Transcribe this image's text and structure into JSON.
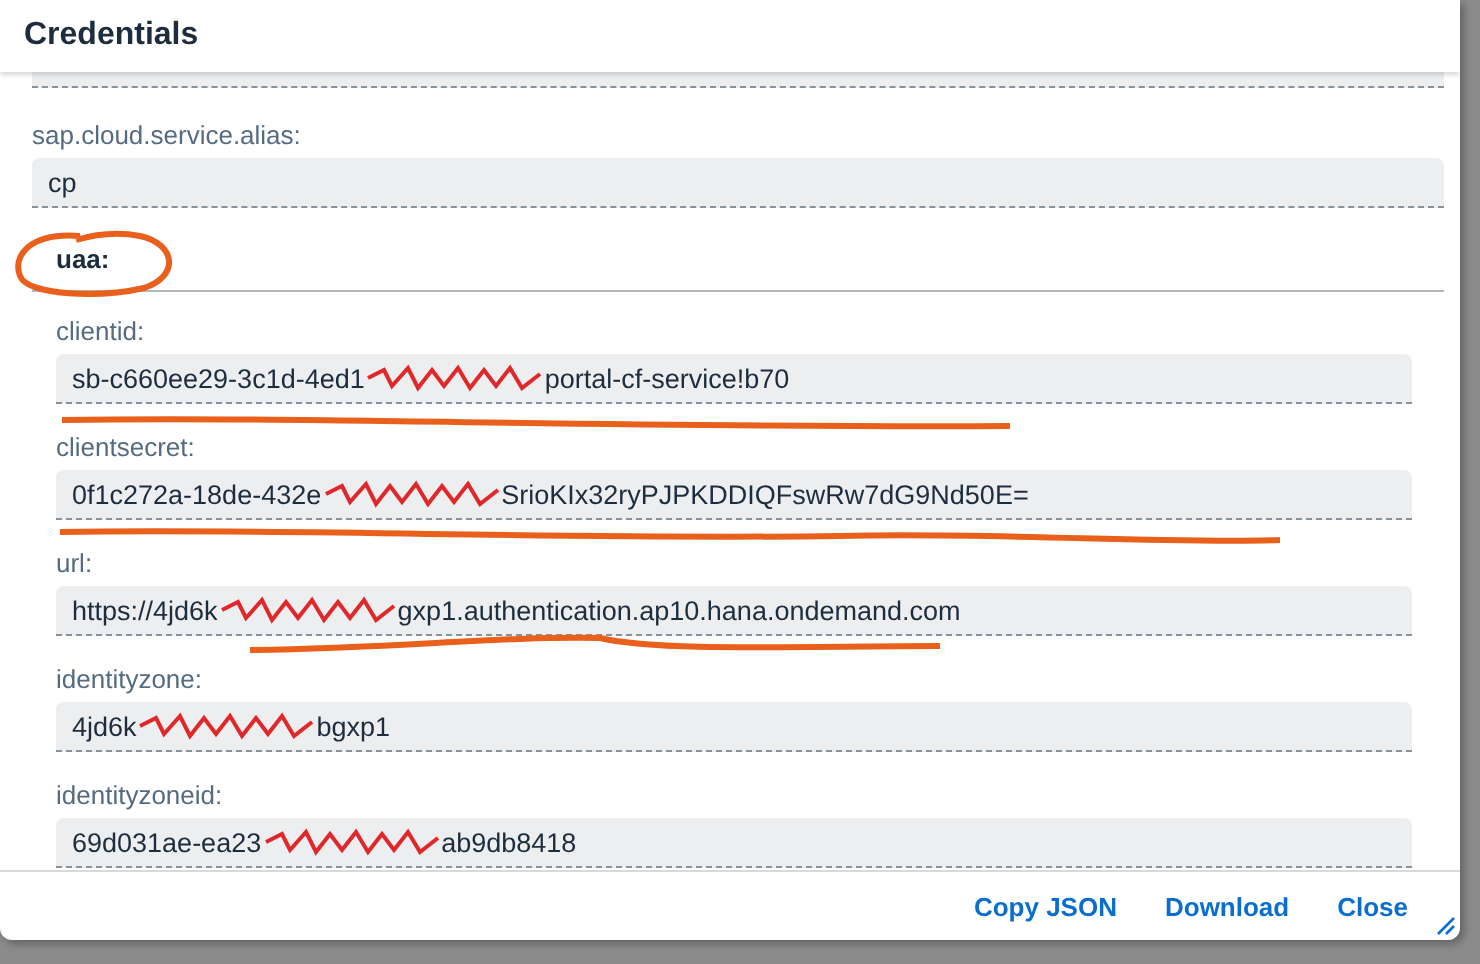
{
  "dialog": {
    "title": "Credentials"
  },
  "fields": [
    {
      "kind": "partial"
    },
    {
      "kind": "field",
      "label": "sap.cloud.service.alias:",
      "value": [
        {
          "kind": "text",
          "text": "cp"
        }
      ]
    },
    {
      "kind": "group",
      "label": "uaa:",
      "children": [
        {
          "kind": "field",
          "label": "clientid:",
          "value": [
            {
              "kind": "text",
              "text": "sb-c660ee29-3c1d-4ed1"
            },
            {
              "kind": "scribble"
            },
            {
              "kind": "text",
              "text": "portal-cf-service!b70"
            }
          ]
        },
        {
          "kind": "field",
          "label": "clientsecret:",
          "value": [
            {
              "kind": "text",
              "text": "0f1c272a-18de-432e"
            },
            {
              "kind": "scribble"
            },
            {
              "kind": "text",
              "text": "SrioKIx32ryPJPKDDIQFswRw7dG9Nd50E="
            }
          ]
        },
        {
          "kind": "field",
          "label": "url:",
          "value": [
            {
              "kind": "text",
              "text": "https://4jd6k"
            },
            {
              "kind": "scribble"
            },
            {
              "kind": "text",
              "text": "gxp1.authentication.ap10.hana.ondemand.com"
            }
          ]
        },
        {
          "kind": "field",
          "label": "identityzone:",
          "value": [
            {
              "kind": "text",
              "text": "4jd6k"
            },
            {
              "kind": "scribble"
            },
            {
              "kind": "text",
              "text": "bgxp1"
            }
          ]
        },
        {
          "kind": "field",
          "label": "identityzoneid:",
          "value": [
            {
              "kind": "text",
              "text": "69d031ae-ea23"
            },
            {
              "kind": "scribble"
            },
            {
              "kind": "text",
              "text": "ab9db8418"
            }
          ]
        }
      ]
    }
  ],
  "buttons": [
    "Copy JSON",
    "Download",
    "Close"
  ]
}
